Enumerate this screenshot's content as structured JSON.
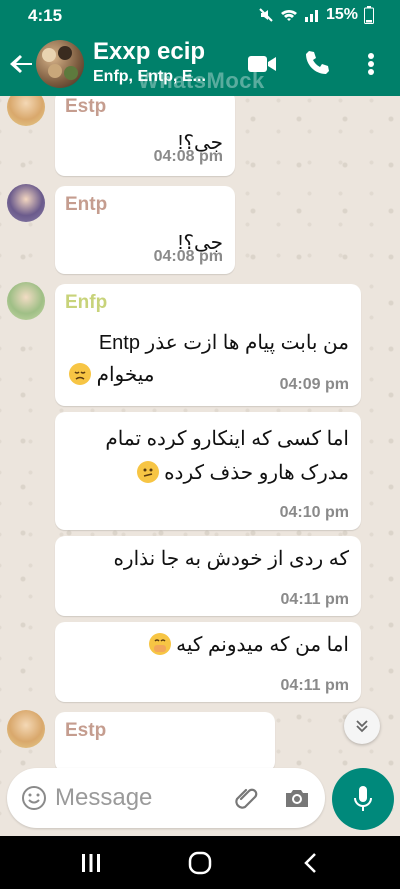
{
  "status_bar": {
    "time": "4:15",
    "battery": "15%"
  },
  "header": {
    "title": "Exxp ecip",
    "subtitle": "Enfp, Entp, E...",
    "watermark": "WhatsMock"
  },
  "colors": {
    "header": "#00806a",
    "estp": "#c59d8f",
    "entp": "#c59d8f",
    "enfp": "#c8d37a",
    "time": "#8a8a8a",
    "mic_button": "#00897b"
  },
  "messages": [
    {
      "sender": "Estp",
      "text": "جی؟!",
      "time": "04:08 pm"
    },
    {
      "sender": "Entp",
      "text": "جی؟!",
      "time": "04:08 pm"
    },
    {
      "sender": "Enfp",
      "line1": "من بابت پیام ها ازت عذر Entp",
      "line2": "میخوام",
      "emoji": "disappointed-face",
      "time": "04:09 pm"
    },
    {
      "line1": "اما کسی که اینکارو کرده تمام",
      "line2": "مدرک هارو حذف کرده",
      "emoji": "confused-face",
      "time": "04:10 pm"
    },
    {
      "text": "که ردی از خودش به جا نذاره",
      "time": "04:11 pm"
    },
    {
      "text": "اما من که میدونم کیه",
      "emoji": "hand-over-mouth-face",
      "time": "04:11 pm"
    },
    {
      "sender": "Estp"
    }
  ],
  "compose": {
    "placeholder": "Message"
  },
  "icons": {
    "back": "arrow-left-icon",
    "video": "video-call-icon",
    "call": "phone-icon",
    "menu": "more-vertical-icon",
    "scroll": "chevron-double-down-icon",
    "emoji": "emoji-icon",
    "attach": "paperclip-icon",
    "camera": "camera-icon",
    "mic": "microphone-icon"
  }
}
